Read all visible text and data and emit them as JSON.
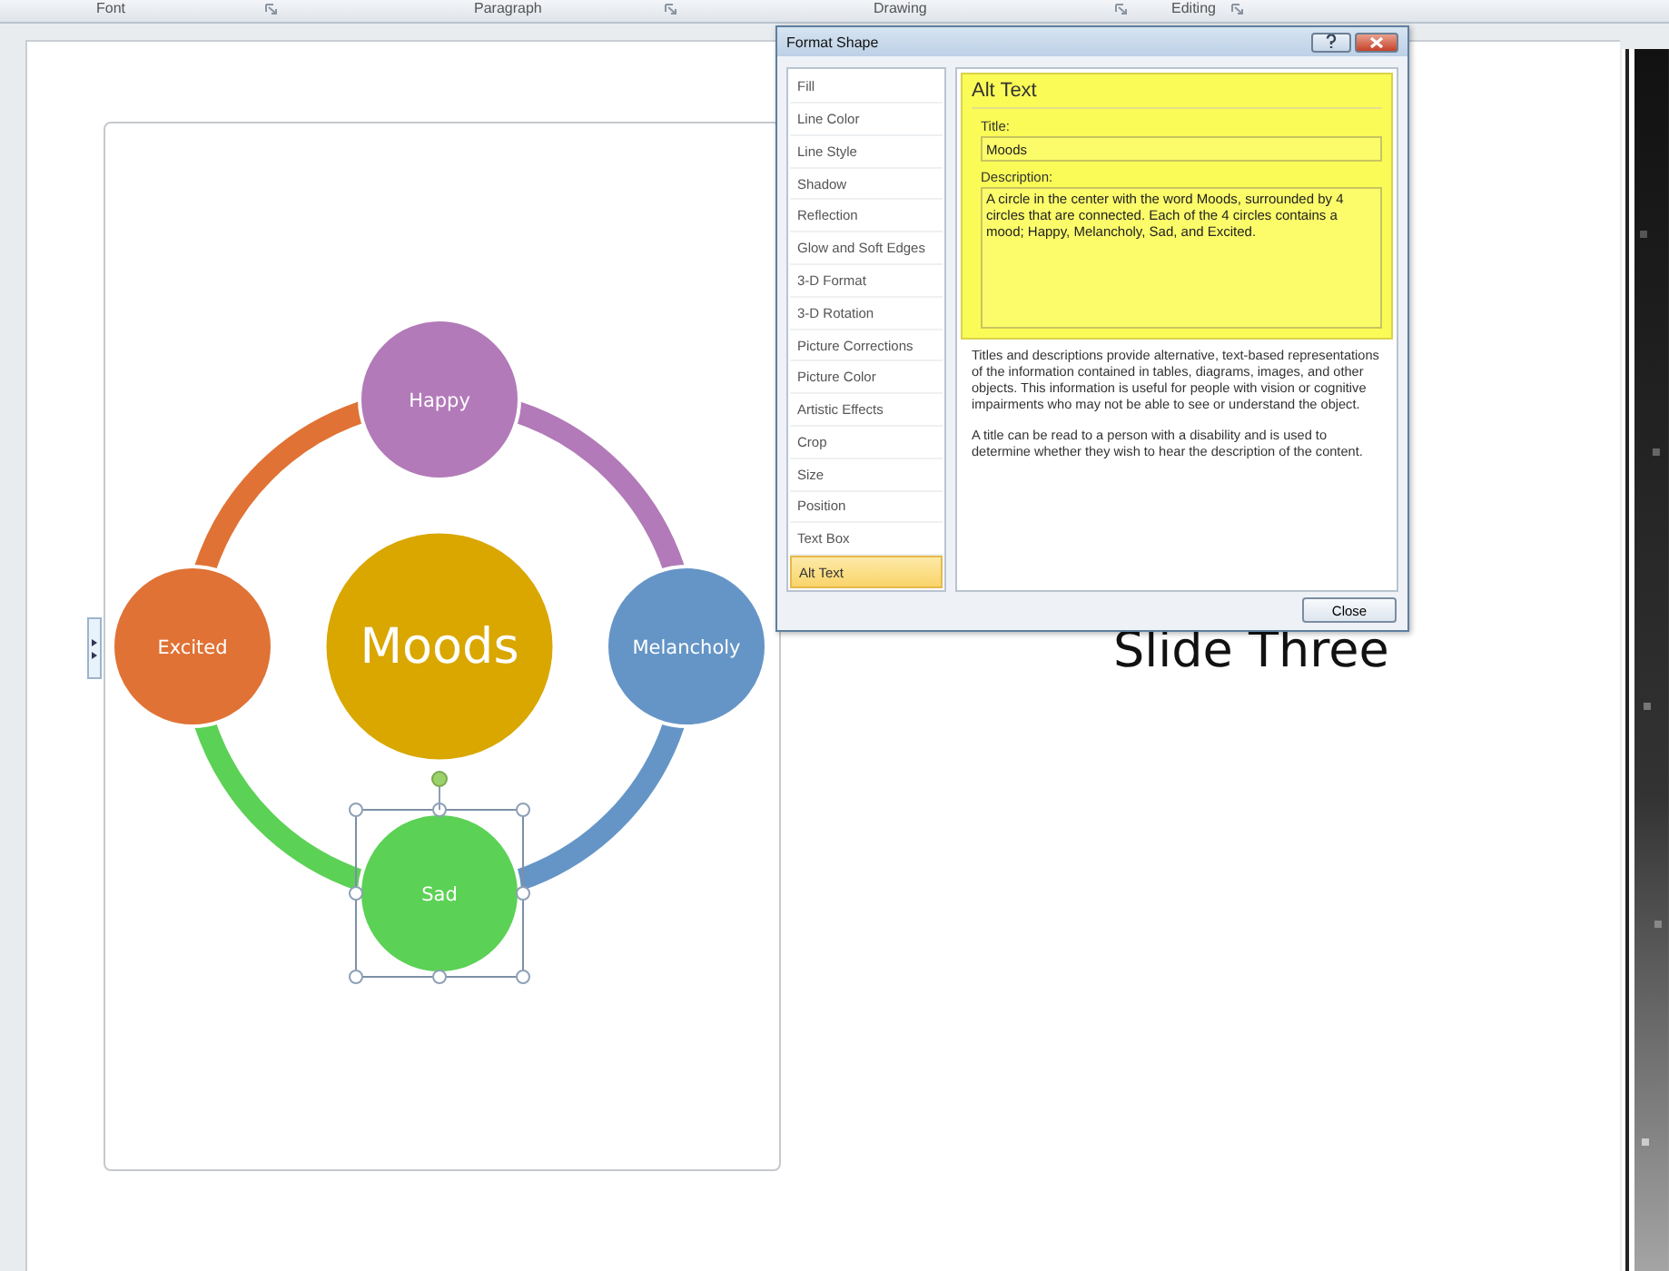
{
  "ribbon_groups": [
    {
      "label": "Font"
    },
    {
      "label": "Paragraph"
    },
    {
      "label": "Drawing"
    },
    {
      "label": "Editing"
    }
  ],
  "diagram": {
    "center": {
      "label": "Moods",
      "color": "#d9a700"
    },
    "nodes": [
      {
        "label": "Happy",
        "color": "#b27ab8",
        "selected": false
      },
      {
        "label": "Melancholy",
        "color": "#6595c6",
        "selected": false
      },
      {
        "label": "Sad",
        "color": "#5bd155",
        "selected": true
      },
      {
        "label": "Excited",
        "color": "#e07235",
        "selected": false
      }
    ]
  },
  "slide_title": "Slide Three",
  "dialog": {
    "title": "Format Shape",
    "categories": [
      {
        "label": "Fill",
        "selected": false
      },
      {
        "label": "Line Color",
        "selected": false
      },
      {
        "label": "Line Style",
        "selected": false
      },
      {
        "label": "Shadow",
        "selected": false
      },
      {
        "label": "Reflection",
        "selected": false
      },
      {
        "label": "Glow and Soft Edges",
        "selected": false
      },
      {
        "label": "3-D Format",
        "selected": false
      },
      {
        "label": "3-D Rotation",
        "selected": false
      },
      {
        "label": "Picture Corrections",
        "selected": false
      },
      {
        "label": "Picture Color",
        "selected": false
      },
      {
        "label": "Artistic Effects",
        "selected": false
      },
      {
        "label": "Crop",
        "selected": false
      },
      {
        "label": "Size",
        "selected": false
      },
      {
        "label": "Position",
        "selected": false
      },
      {
        "label": "Text Box",
        "selected": false
      },
      {
        "label": "Alt Text",
        "selected": true
      }
    ],
    "heading": "Alt Text",
    "title_label": "Title:",
    "title_value": "Moods",
    "description_label": "Description:",
    "description_value": "A circle in the center with the word Moods, surrounded by 4 circles that are connected. Each of the 4 circles contains a mood; Happy, Melancholy, Sad, and Excited.",
    "help": [
      "Titles and descriptions provide alternative, text-based representations of the information contained in tables, diagrams, images, and other objects. This information is useful for people with vision or cognitive impairments who may not be able to see or understand the object.",
      "A title can be read to a person with a disability and is used to determine whether they wish to hear the description of the content."
    ],
    "close_button": "Close"
  }
}
